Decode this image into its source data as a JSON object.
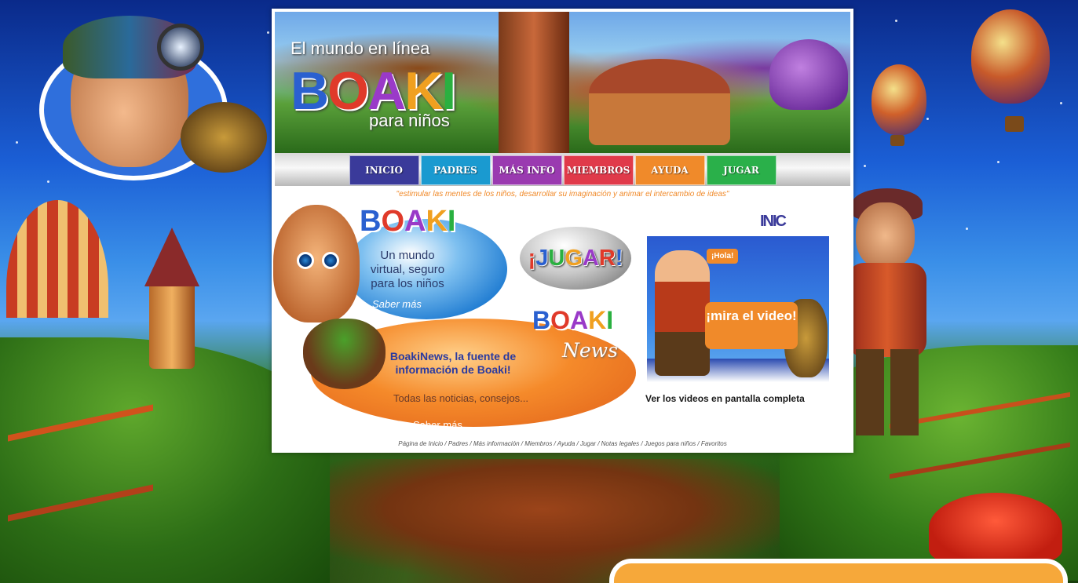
{
  "banner": {
    "tagline": "El mundo en línea",
    "logo_letters": [
      {
        "char": "B",
        "color": "#2a60d0"
      },
      {
        "char": "O",
        "color": "#e03a2a"
      },
      {
        "char": "A",
        "color": "#9a3ac8"
      },
      {
        "char": "K",
        "color": "#f0a020"
      },
      {
        "char": "I",
        "color": "#2ab040"
      }
    ],
    "subtitle": "para niños"
  },
  "nav": {
    "items": [
      {
        "label": "INICIO",
        "color": "#3a3a9a"
      },
      {
        "label": "PADRES",
        "color": "#1a9ad0"
      },
      {
        "label": "MÁS INFO",
        "color": "#9a3ab0"
      },
      {
        "label": "MIEMBROS",
        "color": "#e03a4a"
      },
      {
        "label": "AYUDA",
        "color": "#f08a2a"
      },
      {
        "label": "JUGAR",
        "color": "#2ab04a"
      }
    ]
  },
  "quote": "\"estimular las mentes de los niños, desarrollar su imaginación y animar el intercambio de ideas\"",
  "virtual_card": {
    "description": "Un mundo virtual, seguro para los niños",
    "more_link": "Saber más"
  },
  "play_button": {
    "letters": [
      {
        "char": "¡",
        "color": "#e03a2a"
      },
      {
        "char": "J",
        "color": "#2a60d0"
      },
      {
        "char": "U",
        "color": "#2ab040"
      },
      {
        "char": "G",
        "color": "#f0a020"
      },
      {
        "char": "A",
        "color": "#9a3ac8"
      },
      {
        "char": "R",
        "color": "#e03a2a"
      },
      {
        "char": "!",
        "color": "#2a60d0"
      }
    ]
  },
  "video": {
    "inic_logo": "INIC",
    "hola_label": "¡Hola!",
    "watch_label": "¡mira el video!",
    "fullscreen_link": "Ver los videos en pantalla completa"
  },
  "news_card": {
    "news_word": "News",
    "headline": "BoakiNews, la fuente de información de Boaki!",
    "subtext": "Todas las noticias, consejos...",
    "more_link": "Saber más..."
  },
  "footer_links": "Página de Inicio / Padres / Más información / Miembros / Ayuda / Jugar / Notas legales / Juegos para niños / Favoritos",
  "colors": {
    "accent_orange": "#f08a2a",
    "sky_blue": "#1b5fd6",
    "grass_green": "#2d6e16"
  }
}
